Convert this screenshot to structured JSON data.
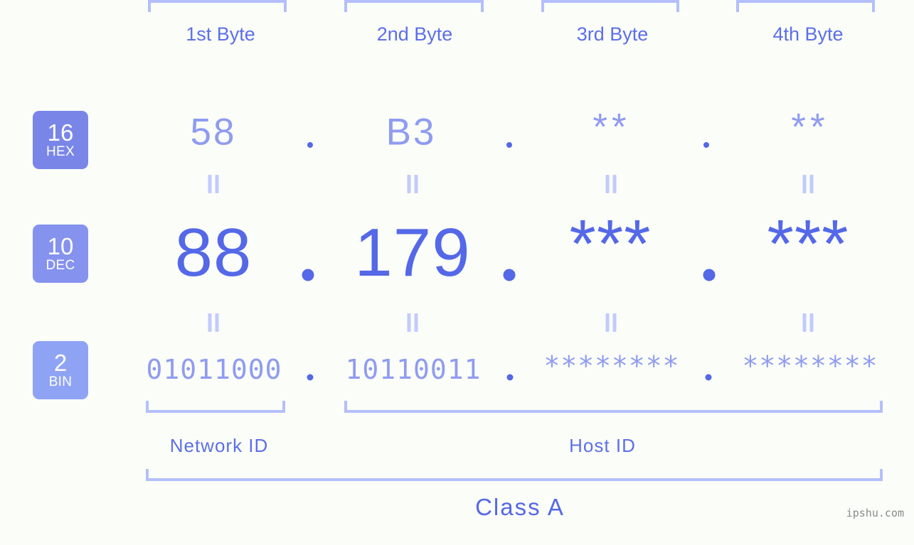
{
  "page": {
    "background_color": "#fbfdf8",
    "accent_strong": "#5468e8",
    "accent_light": "#8f9cf0",
    "accent_pale": "#b4bffb",
    "watermark": "ipshu.com"
  },
  "byte_headers": [
    {
      "label": "1st Byte"
    },
    {
      "label": "2nd Byte"
    },
    {
      "label": "3rd Byte"
    },
    {
      "label": "4th Byte"
    }
  ],
  "bases": [
    {
      "number": "16",
      "name": "HEX",
      "color": "#7986e8"
    },
    {
      "number": "10",
      "name": "DEC",
      "color": "#8592ee"
    },
    {
      "number": "2",
      "name": "BIN",
      "color": "#8fa3f5"
    }
  ],
  "rows": {
    "hex": {
      "base_number": "16",
      "base_name": "HEX",
      "bytes": [
        "58",
        "B3",
        "**",
        "**"
      ],
      "separator": "."
    },
    "dec": {
      "base_number": "10",
      "base_name": "DEC",
      "bytes": [
        "88",
        "179",
        "***",
        "***"
      ],
      "separator": "."
    },
    "bin": {
      "base_number": "2",
      "base_name": "BIN",
      "bytes": [
        "01011000",
        "10110011",
        "********",
        "********"
      ],
      "separator": "."
    }
  },
  "equals_symbol": "||",
  "segments": {
    "network_id": "Network ID",
    "host_id": "Host ID"
  },
  "class": {
    "label": "Class A"
  }
}
